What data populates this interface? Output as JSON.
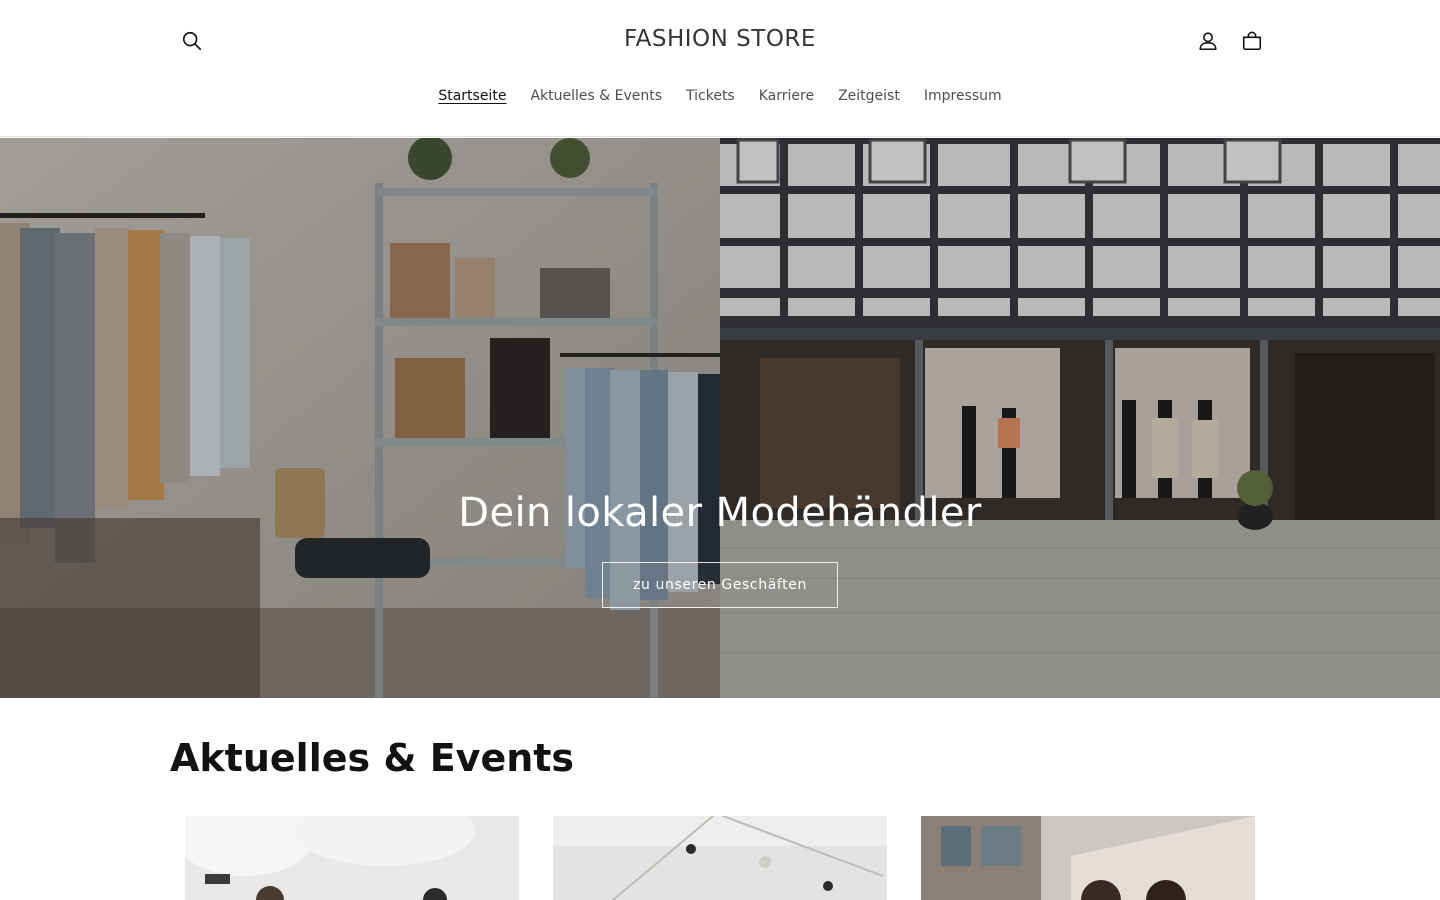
{
  "header": {
    "logo": "FASHION STORE",
    "icons": {
      "search": "search-icon",
      "account": "account-icon",
      "cart": "cart-icon"
    }
  },
  "nav": {
    "items": [
      {
        "label": "Startseite",
        "active": true
      },
      {
        "label": "Aktuelles & Events",
        "active": false
      },
      {
        "label": "Tickets",
        "active": false
      },
      {
        "label": "Karriere",
        "active": false
      },
      {
        "label": "Zeitgeist",
        "active": false
      },
      {
        "label": "Impressum",
        "active": false
      }
    ]
  },
  "hero": {
    "title": "Dein lokaler Modehändler",
    "button_label": "zu unseren Geschäften"
  },
  "events": {
    "title": "Aktuelles & Events"
  },
  "colors": {
    "text": "#121212",
    "background": "#ffffff",
    "hero_text": "#ffffff"
  }
}
